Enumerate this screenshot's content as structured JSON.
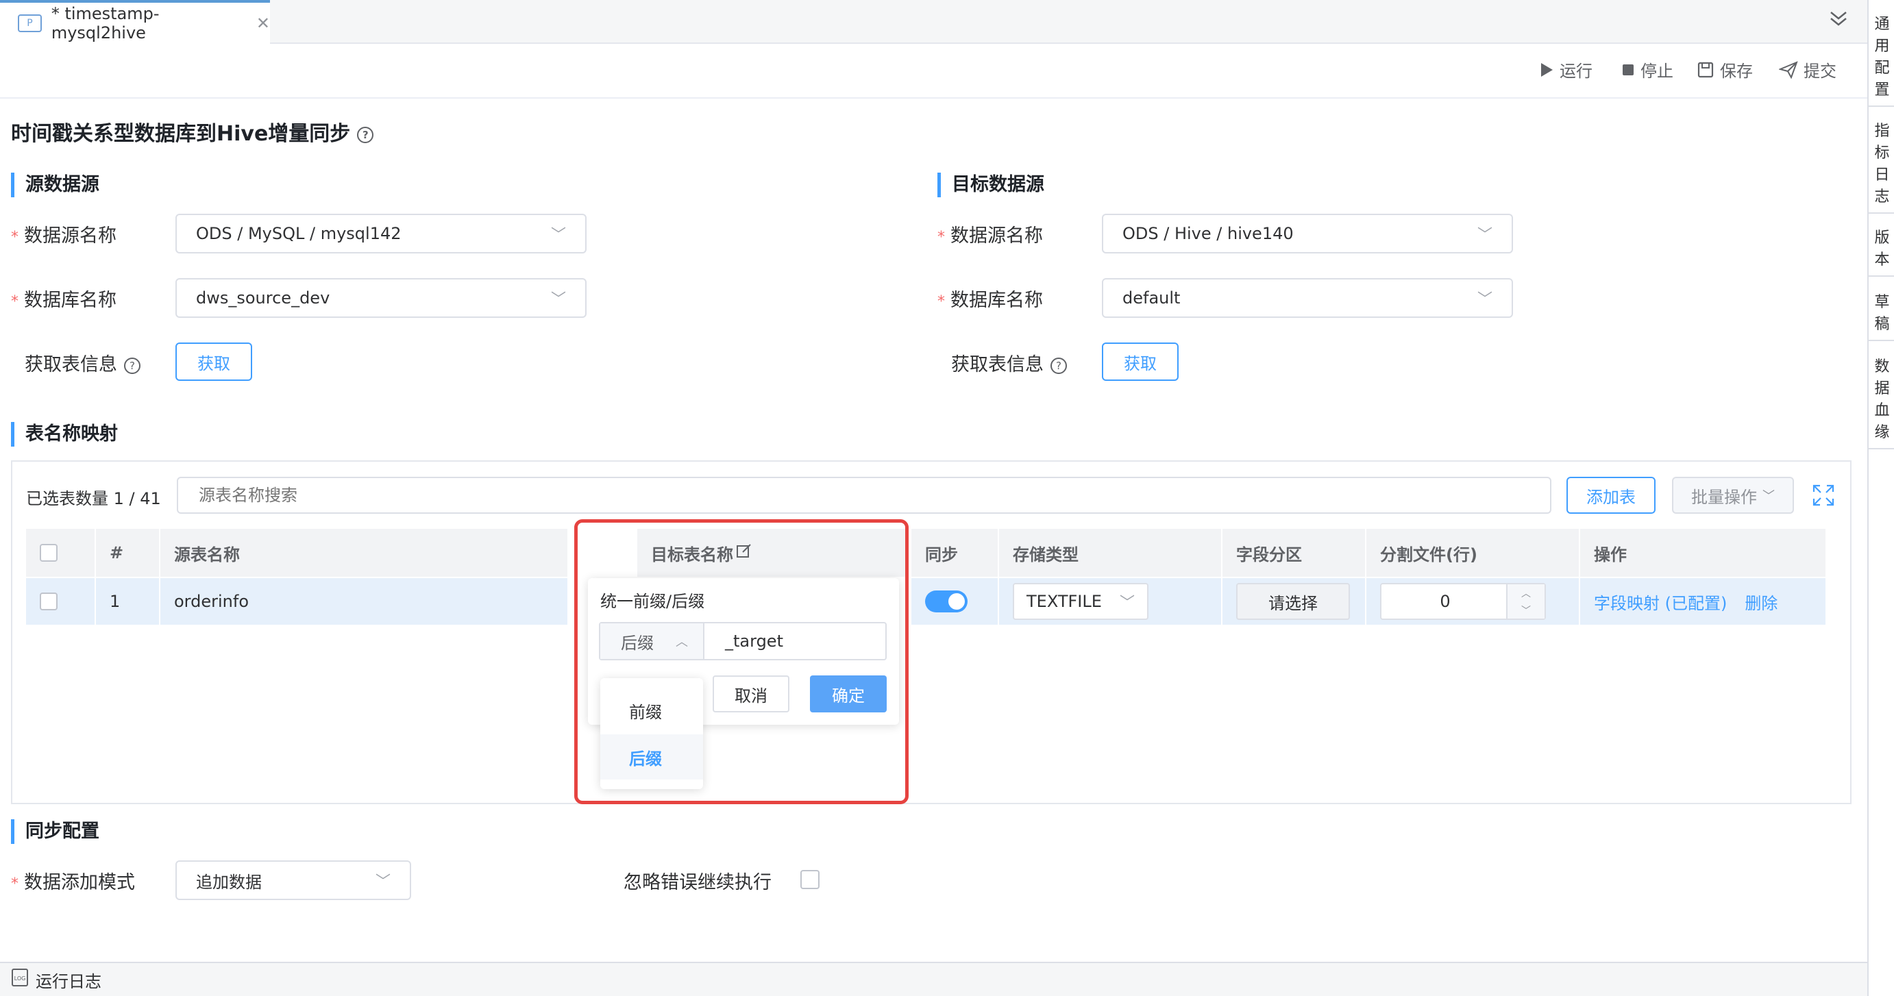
{
  "tab": {
    "icon_text": "P",
    "title": "* timestamp-mysql2hive",
    "close": "✕"
  },
  "toolbar": {
    "run": "运行",
    "stop": "停止",
    "save": "保存",
    "submit": "提交"
  },
  "sidebar": [
    "通\n用\n配\n置",
    "指\n标\n日\n志",
    "版\n本",
    "草\n稿",
    "数\n据\n血\n缘"
  ],
  "page_title": "时间戳关系型数据库到Hive增量同步",
  "source": {
    "heading": "源数据源",
    "ds_label": "数据源名称",
    "ds_value": "ODS / MySQL / mysql142",
    "db_label": "数据库名称",
    "db_value": "dws_source_dev",
    "fetch_label": "获取表信息",
    "fetch_btn": "获取"
  },
  "target": {
    "heading": "目标数据源",
    "ds_label": "数据源名称",
    "ds_value": "ODS / Hive / hive140",
    "db_label": "数据库名称",
    "db_value": "default",
    "fetch_label": "获取表信息",
    "fetch_btn": "获取"
  },
  "mapping": {
    "heading": "表名称映射",
    "selected_count": "已选表数量 1 / 41",
    "search_placeholder": "源表名称搜索",
    "add_btn": "添加表",
    "batch_btn": "批量操作",
    "columns": [
      "#",
      "源表名称",
      "目标表名称",
      "同步",
      "存储类型",
      "字段分区",
      "分割文件(行)",
      "操作"
    ],
    "rows": [
      {
        "index": "1",
        "source_table": "orderinfo",
        "storage": "TEXTFILE",
        "partition": "请选择",
        "split": "0",
        "action_mapping": "字段映射 (已配置)",
        "action_delete": "删除"
      }
    ]
  },
  "popover": {
    "title": "统一前缀/后缀",
    "mode": "后缀",
    "value": "_target",
    "cancel": "取消",
    "confirm": "确定",
    "options": [
      "前缀",
      "后缀"
    ]
  },
  "sync": {
    "heading": "同步配置",
    "mode_label": "数据添加模式",
    "mode_value": "追加数据",
    "ignore_label": "忽略错误继续执行"
  },
  "bottom": {
    "log": "运行日志"
  }
}
